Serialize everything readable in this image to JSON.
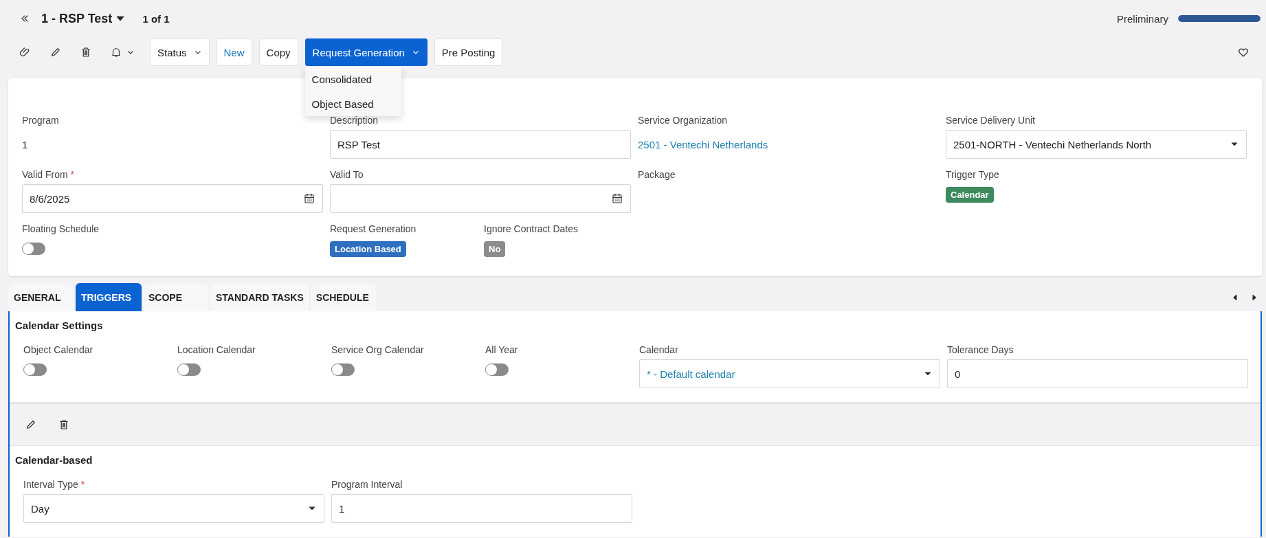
{
  "header": {
    "title": "1 - RSP Test",
    "count": "1 of 1",
    "status": "Preliminary",
    "progress": {
      "level": 1
    }
  },
  "toolbar": {
    "buttons": [
      {
        "label": "Status",
        "kind": "menu"
      },
      {
        "label": "New",
        "kind": "link"
      },
      {
        "label": "Copy",
        "kind": "plain"
      },
      {
        "label": "Request Generation",
        "kind": "primary",
        "expanded": true
      },
      {
        "label": "Pre Posting",
        "kind": "plain"
      }
    ],
    "menu_items": [
      "Consolidated",
      "Object Based"
    ]
  },
  "form": {
    "rows": [
      [
        {
          "label": "Program",
          "kind": "static",
          "value": "1"
        },
        {
          "label": "Description",
          "kind": "input",
          "value": "RSP Test"
        },
        {
          "label": "Service Organization",
          "kind": "link",
          "value": "2501 - Ventechi Netherlands"
        },
        {
          "label": "Service Delivery Unit",
          "kind": "select",
          "value": "2501-NORTH - Ventechi Netherlands North"
        }
      ],
      [
        {
          "label": "Valid From",
          "kind": "date",
          "value": "8/6/2025",
          "required_mark": "*"
        },
        {
          "label": "Valid To",
          "kind": "date"
        },
        {
          "label": "Package",
          "kind": "static"
        },
        {
          "label": "Trigger Type",
          "kind": "badge",
          "value": "Calendar",
          "color": "#3d8a5e"
        }
      ],
      [
        {
          "label": "Floating Schedule",
          "kind": "toggle",
          "on": false
        },
        {
          "label": "Request Generation",
          "kind": "badge",
          "value": "Location Based",
          "color": "#2f6fbf"
        },
        {
          "label": "Ignore Contract Dates",
          "kind": "badge",
          "value": "No",
          "color": "#8c8c8c"
        }
      ]
    ]
  },
  "tabs": [
    {
      "label": "GENERAL",
      "selected": false
    },
    {
      "label": "TRIGGERS",
      "selected": true
    },
    {
      "label": "SCOPE",
      "selected": false
    },
    {
      "label": "STANDARD TASKS",
      "selected": false
    },
    {
      "label": "SCHEDULE",
      "selected": false
    }
  ],
  "calendar_settings": {
    "title": "Calendar Settings",
    "fields": [
      {
        "label": "Object Calendar",
        "kind": "toggle",
        "on": false
      },
      {
        "label": "Location Calendar",
        "kind": "toggle",
        "on": false
      },
      {
        "label": "Service Org Calendar",
        "kind": "toggle",
        "on": false
      },
      {
        "label": "All Year",
        "kind": "toggle",
        "on": false
      },
      {
        "label": "Calendar",
        "kind": "select",
        "value": "* - Default calendar",
        "link": true
      },
      {
        "label": "Tolerance Days",
        "kind": "input",
        "value": "0"
      }
    ]
  },
  "calendar_based": {
    "title": "Calendar-based",
    "fields": [
      {
        "label": "Interval Type",
        "kind": "select",
        "value": "Day",
        "required_mark": "*"
      },
      {
        "label": "Program Interval",
        "kind": "input",
        "value": "1"
      }
    ]
  }
}
